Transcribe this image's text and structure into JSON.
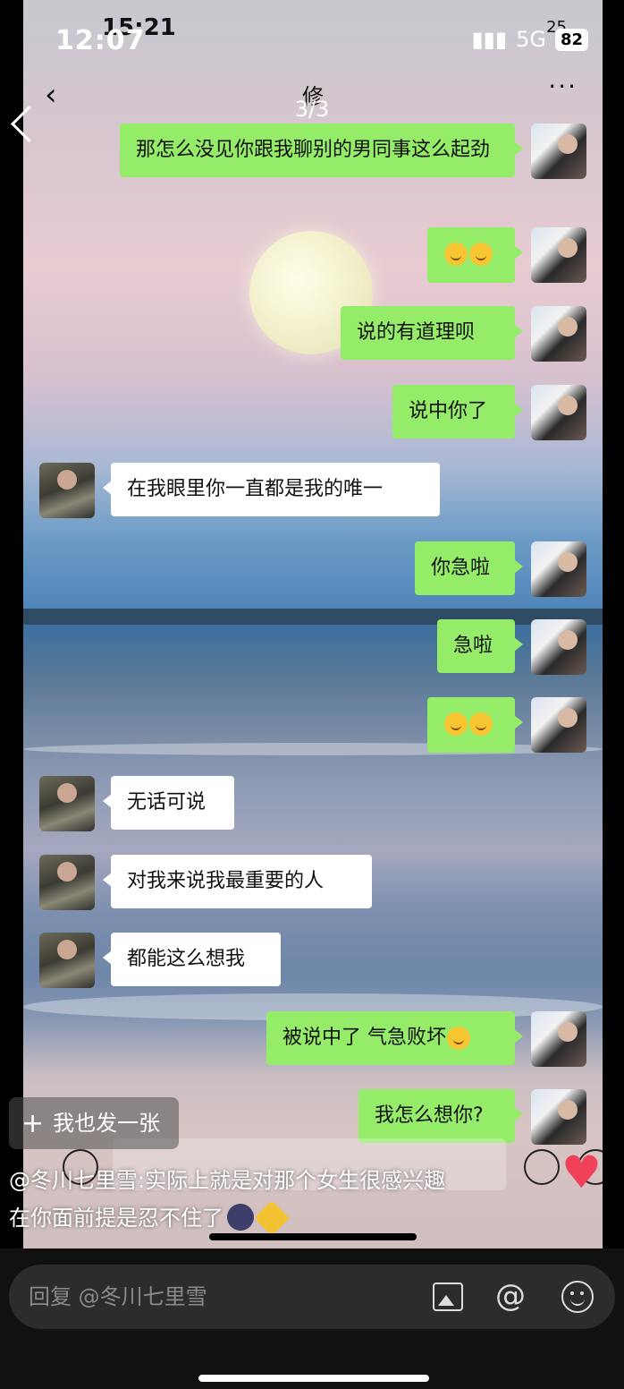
{
  "outer_status": {
    "time": "12:07",
    "network": "5G",
    "battery": "82"
  },
  "inner_status": {
    "time": "15:21",
    "battery": "25"
  },
  "viewer": {
    "page_counter": "3/3"
  },
  "chat": {
    "contact_name": "修",
    "messages": [
      {
        "from": "me",
        "text": "那怎么没见你跟我聊别的男同事这么起劲"
      },
      {
        "from": "me",
        "text": "😊😊"
      },
      {
        "from": "me",
        "text": "说的有道理呗"
      },
      {
        "from": "me",
        "text": "说中你了"
      },
      {
        "from": "them",
        "text": "在我眼里你一直都是我的唯一"
      },
      {
        "from": "me",
        "text": "你急啦"
      },
      {
        "from": "me",
        "text": "急啦"
      },
      {
        "from": "me",
        "text": "😊😊"
      },
      {
        "from": "them",
        "text": "无话可说"
      },
      {
        "from": "them",
        "text": "对我来说我最重要的人"
      },
      {
        "from": "them",
        "text": "都能这么想我"
      },
      {
        "from": "me",
        "text": "被说中了 气急败坏😊"
      },
      {
        "from": "me",
        "text": "我怎么想你?"
      }
    ]
  },
  "overlay": {
    "post_button_label": "我也发一张",
    "caption_line1": "@冬川七里雪:实际上就是对那个女生很感兴趣",
    "caption_line2": "在你面前提是忍不住了"
  },
  "reply_bar": {
    "placeholder": "回复 @冬川七里雪"
  },
  "icons": {
    "back": "chevron-left-icon",
    "more": "more-dots-icon",
    "image": "image-icon",
    "mention": "at-icon",
    "emoji": "smile-icon",
    "like": "heart-icon"
  }
}
